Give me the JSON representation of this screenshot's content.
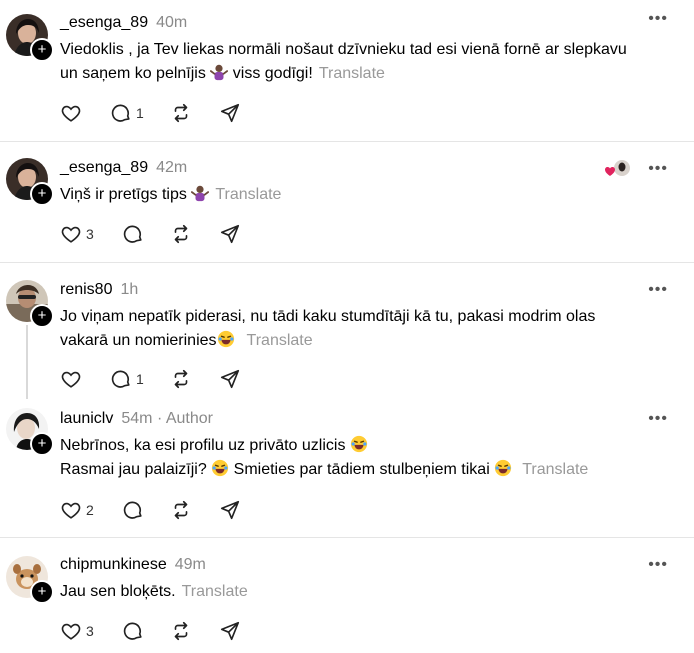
{
  "posts": [
    {
      "username": "_esenga_89",
      "time": "40m",
      "author": "",
      "line1": "Viedoklis , ja Tev liekas normāli nošaut dzīvnieku tad esi vienā fornē ar slepkavu",
      "line2": "un saņem ko pelnījis",
      "line2b": "viss godīgi!",
      "translate": "Translate",
      "likes": "",
      "replies": "1",
      "emoji": "shrug"
    },
    {
      "username": "_esenga_89",
      "time": "42m",
      "author": "",
      "line1": "Viņš ir pretīgs tips",
      "translate": "Translate",
      "likes": "3",
      "replies": "",
      "emoji": "shrug"
    },
    {
      "username": "renis80",
      "time": "1h",
      "author": "",
      "line1": "Jo viņam nepatīk piderasi, nu tādi kaku stumdītāji kā tu, pakasi modrim olas",
      "line2": "vakarā un nomierinies",
      "translate": "Translate",
      "likes": "",
      "replies": "1",
      "emoji": "laugh"
    },
    {
      "username": "launiclv",
      "time": "54m",
      "author": "· Author",
      "line1": "Nebrīnos, ka esi profilu uz privāto uzlicis",
      "line2a": "Rasmai jau palaizīji?",
      "line2b": "Smieties par tādiem stulbeņiem tikai",
      "translate": "Translate",
      "likes": "2",
      "replies": "",
      "emoji": "laugh"
    },
    {
      "username": "chipmunkinese",
      "time": "49m",
      "author": "",
      "line1": "Jau sen bloķēts.",
      "translate": "Translate",
      "likes": "3",
      "replies": "",
      "emoji": ""
    }
  ],
  "icons": [
    "heart-icon",
    "comment-icon",
    "repost-icon",
    "share-icon",
    "more-icon",
    "plus-icon"
  ],
  "colors": {
    "muted": "#999999",
    "divider": "#e5e5e5",
    "like_red": "#e0245e"
  }
}
